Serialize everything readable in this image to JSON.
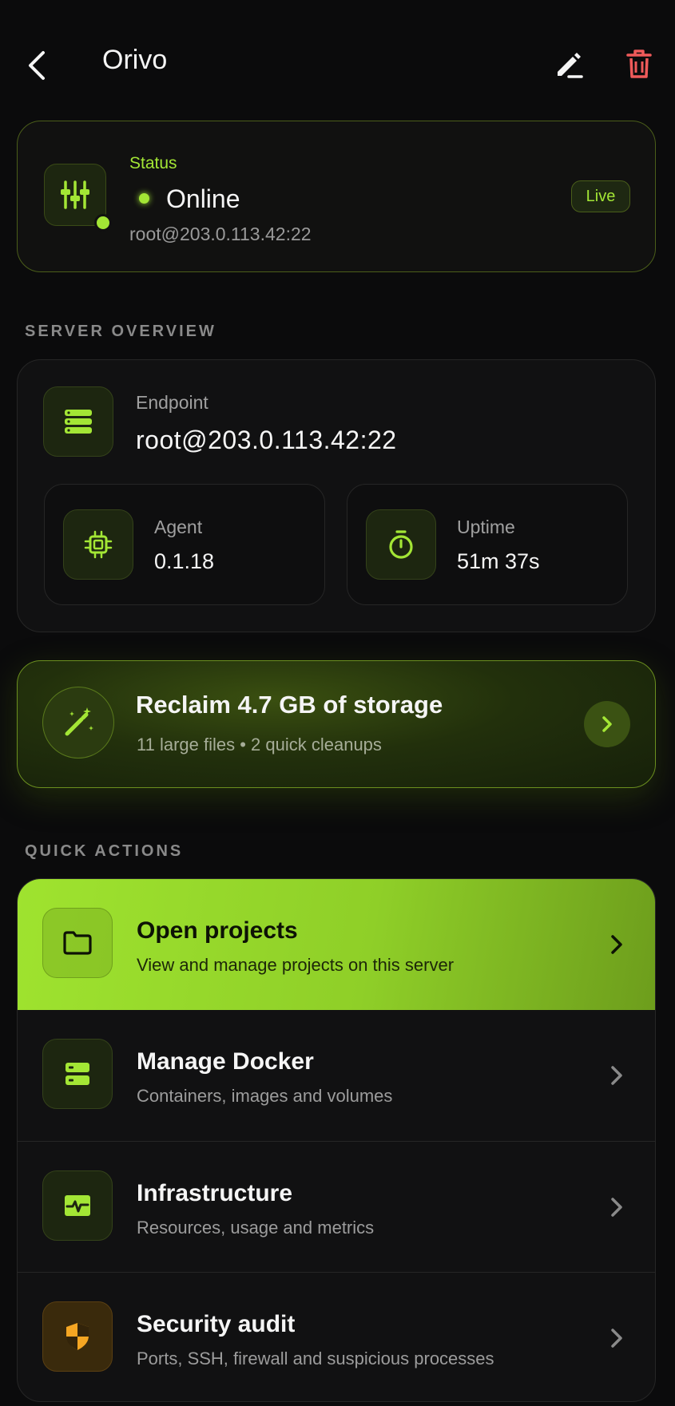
{
  "header": {
    "title": "Orivo",
    "back_icon": "chevron-left-icon",
    "edit_icon": "pencil-icon",
    "delete_icon": "trash-icon",
    "delete_color": "#ef5a5a"
  },
  "status": {
    "label": "Status",
    "state": "Online",
    "endpoint": "root@203.0.113.42:22",
    "badge": "Live",
    "icon": "sliders-icon",
    "accent": "#a3e635"
  },
  "overview": {
    "section_title": "SERVER OVERVIEW",
    "endpoint_label": "Endpoint",
    "endpoint_value": "root@203.0.113.42:22",
    "agent_label": "Agent",
    "agent_value": "0.1.18",
    "uptime_label": "Uptime",
    "uptime_value": "51m 37s"
  },
  "reclaim": {
    "title": "Reclaim 4.7 GB of storage",
    "subtitle": "11 large files • 2 quick cleanups",
    "icon": "magic-wand-icon"
  },
  "quick_actions": {
    "section_title": "QUICK ACTIONS",
    "items": [
      {
        "title": "Open projects",
        "subtitle": "View and manage projects on this server",
        "icon": "folder-icon"
      },
      {
        "title": "Manage Docker",
        "subtitle": "Containers, images and volumes",
        "icon": "server-stack-icon"
      },
      {
        "title": "Infrastructure",
        "subtitle": "Resources, usage and metrics",
        "icon": "activity-icon"
      },
      {
        "title": "Security audit",
        "subtitle": "Ports, SSH, firewall and suspicious processes",
        "icon": "shield-icon"
      }
    ]
  }
}
